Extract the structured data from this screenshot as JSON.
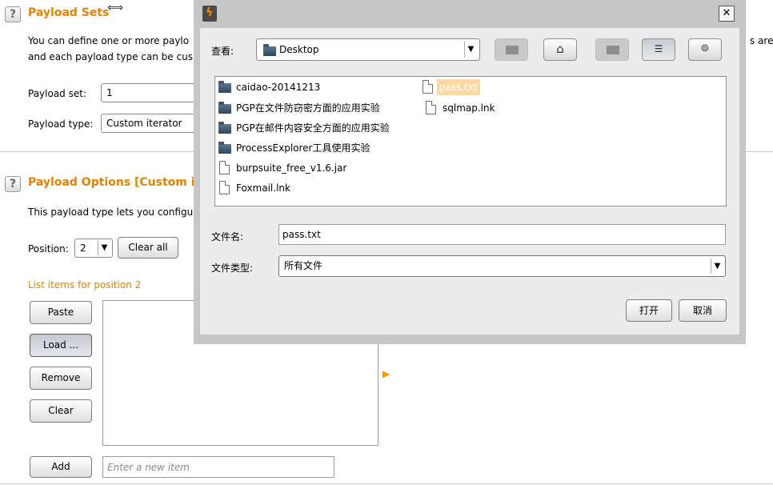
{
  "sets_section": {
    "title": "Payload Sets",
    "desc_line1": "You can define one or more paylo",
    "desc_line1_right": "s are a",
    "desc_line2": "and each payload type can be cus",
    "payload_set_label": "Payload set:",
    "payload_set_value": "1",
    "payload_type_label": "Payload type:",
    "payload_type_value": "Custom iterator"
  },
  "options_section": {
    "title": "Payload Options [Custom i",
    "desc": "This payload type lets you configu",
    "position_label": "Position:",
    "position_value": "2",
    "clear_all_label": "Clear all",
    "list_label": "List items for position 2",
    "buttons": {
      "paste": "Paste",
      "load": "Load ...",
      "remove": "Remove",
      "clear": "Clear",
      "add": "Add"
    },
    "new_item_placeholder": "Enter a new item"
  },
  "dialog": {
    "look_in_label": "查看:",
    "look_in_value": "Desktop",
    "files": [
      {
        "name": "caidao-20141213",
        "type": "folder"
      },
      {
        "name": "PGP在文件防窃密方面的应用实验",
        "type": "folder"
      },
      {
        "name": "PGP在邮件内容安全方面的应用实验",
        "type": "folder"
      },
      {
        "name": "ProcessExplorer工具使用实验",
        "type": "folder"
      },
      {
        "name": "burpsuite_free_v1.6.jar",
        "type": "file"
      },
      {
        "name": "Foxmail.lnk",
        "type": "file"
      },
      {
        "name": "pass.txt",
        "type": "file",
        "selected": true
      },
      {
        "name": "sqlmap.lnk",
        "type": "file"
      }
    ],
    "filename_label": "文件名:",
    "filename_value": "pass.txt",
    "filetype_label": "文件类型:",
    "filetype_value": "所有文件",
    "open_label": "打开",
    "cancel_label": "取消",
    "close_symbol": "✕"
  },
  "colors": {
    "accent_orange": "#e58200",
    "selection": "#fcd9a3",
    "dialog_frame": "#c6c6c6"
  }
}
